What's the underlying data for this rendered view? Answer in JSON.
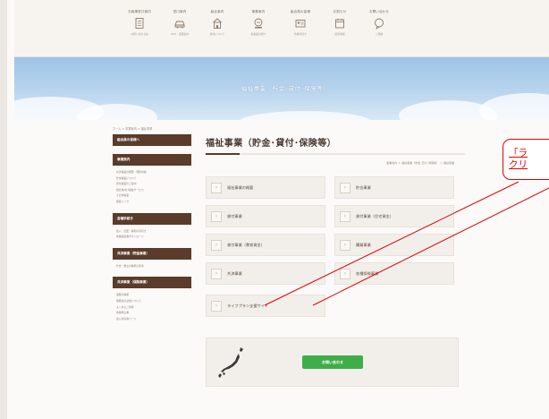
{
  "nav": {
    "items": [
      {
        "label": "お客様窓口案内",
        "sub": "お問い合わせ先",
        "icon": "document-icon"
      },
      {
        "label": "窓口案内",
        "sub": "ATM・店舗案内",
        "icon": "car-icon"
      },
      {
        "label": "組合案内",
        "sub": "組合について",
        "icon": "building-icon"
      },
      {
        "label": "事業案内",
        "sub": "各事業の紹介",
        "icon": "list-icon"
      },
      {
        "label": "組合員の皆様",
        "sub": "各種手続き",
        "icon": "id-card-icon"
      },
      {
        "label": "お知らせ",
        "sub": "最新情報",
        "icon": "calendar-icon"
      },
      {
        "label": "お問い合わせ",
        "sub": "ご相談",
        "icon": "chat-icon"
      }
    ]
  },
  "hero": {
    "title": "福祉事業（貯金･貸付･保険等）"
  },
  "breadcrumb": "ホーム > 事業案内 > 福祉事業",
  "sidebar": {
    "sections": [
      {
        "heading": "組合員の皆様へ",
        "items": []
      },
      {
        "heading": "事業案内",
        "items": [
          "共済事業の概要・保障内容",
          "貯金事業について",
          "貸付事業のご案内",
          "組合員向け福祉サービス",
          "その他事業",
          "関連リンク"
        ]
      },
      {
        "heading": "各種手続き",
        "items": [
          "加入・変更・解約の手続き",
          "各種届出書ダウンロード"
        ]
      },
      {
        "heading": "共済事業（貯金事業）",
        "items": [
          "貯金・積立の種類と利率"
        ]
      },
      {
        "heading": "共済事業（保険事業）",
        "items": [
          "保険の種類",
          "保険金の請求について",
          "よくあるご質問",
          "各種申込書",
          "加入者専用ページ"
        ]
      }
    ]
  },
  "main": {
    "title": "福祉事業（貯金･貸付･保険等）",
    "breadcrumb": "事業案内 ＞ 福祉事業（貯金･貸付･保険等） ＞ 福祉事業",
    "links": [
      "福祉事業の概要",
      "貯金事業",
      "貸付事業",
      "貸付事業（住宅資金）",
      "貸付事業（教育資金）",
      "購買事業",
      "共済事業",
      "各種保険事業",
      "ライフプラン支援サイト"
    ],
    "contact_button": "お問い合わせ"
  },
  "annotation": {
    "line1": "「ラ",
    "line2": "クリ"
  },
  "colors": {
    "accent_brown": "#5b3b2a",
    "button_green": "#3fae49",
    "annotation_red": "#e00000",
    "sky": "#b9d5ee"
  }
}
